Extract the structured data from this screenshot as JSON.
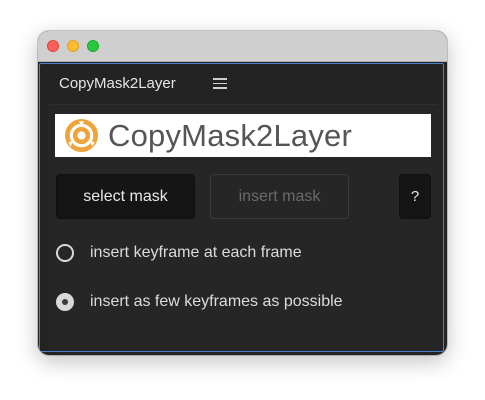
{
  "window": {
    "controls": [
      "close",
      "minimize",
      "zoom"
    ]
  },
  "panel": {
    "tab_title": "CopyMask2Layer",
    "menu_icon": "hamburger-menu-icon"
  },
  "banner": {
    "logo_icon": "copymask2layer-logo-icon",
    "text": "CopyMask2Layer",
    "accent_color": "#f0a33a"
  },
  "buttons": {
    "select_mask": "select mask",
    "insert_mask": "insert mask",
    "help": "?"
  },
  "options": [
    {
      "label": "insert keyframe at each frame",
      "selected": false
    },
    {
      "label": "insert as few keyframes as possible",
      "selected": true
    }
  ]
}
